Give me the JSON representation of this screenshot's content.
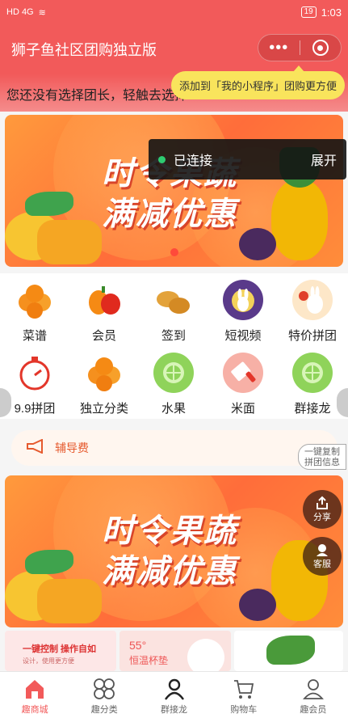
{
  "status_bar": {
    "time": "1:03",
    "battery": "19",
    "signal": "HD 4G"
  },
  "header": {
    "title": "狮子鱼社区团购独立版",
    "menu_dots": "•••"
  },
  "notice": {
    "text": "您还没有选择团长，轻触去选择"
  },
  "tip": {
    "text": "添加到「我的小程序」团购更方便"
  },
  "toast": {
    "status": "已连接",
    "action": "展开"
  },
  "banner": {
    "line1": "时令果蔬",
    "line2": "满减优惠"
  },
  "grid": {
    "row1": [
      {
        "label": "菜谱",
        "icon": "oranges-icon"
      },
      {
        "label": "会员",
        "icon": "peppers-icon"
      },
      {
        "label": "签到",
        "icon": "nuggets-icon"
      },
      {
        "label": "短视频",
        "icon": "rabbit-icon"
      },
      {
        "label": "特价拼团",
        "icon": "rabbit-lantern-icon"
      }
    ],
    "row2": [
      {
        "label": "9.9拼团",
        "icon": "stopwatch-icon"
      },
      {
        "label": "独立分类",
        "icon": "oranges-icon"
      },
      {
        "label": "水果",
        "icon": "lime-icon"
      },
      {
        "label": "米面",
        "icon": "cleaver-icon"
      },
      {
        "label": "群接龙",
        "icon": "lime-icon"
      }
    ]
  },
  "notice2": {
    "text": "辅导费"
  },
  "copy_button": {
    "line1": "一键复制",
    "line2": "拼团信息"
  },
  "float": {
    "share": "分享",
    "service": "客服"
  },
  "promo": {
    "card1_title": "一键控制 操作自如",
    "card1_sub": "设计，使用更方便",
    "card2_title": "55°",
    "card2_sub": "恒温杯垫"
  },
  "tabbar": [
    {
      "label": "趣商城",
      "icon": "home-icon"
    },
    {
      "label": "趣分类",
      "icon": "category-icon"
    },
    {
      "label": "群接龙",
      "icon": "person-icon"
    },
    {
      "label": "购物车",
      "icon": "cart-icon"
    },
    {
      "label": "趣会员",
      "icon": "member-icon"
    }
  ],
  "colors": {
    "brand": "#f25a5a",
    "banner_orange": "#ff7a3a",
    "tip_yellow": "#f9e45c",
    "connected_green": "#2ecc71"
  }
}
